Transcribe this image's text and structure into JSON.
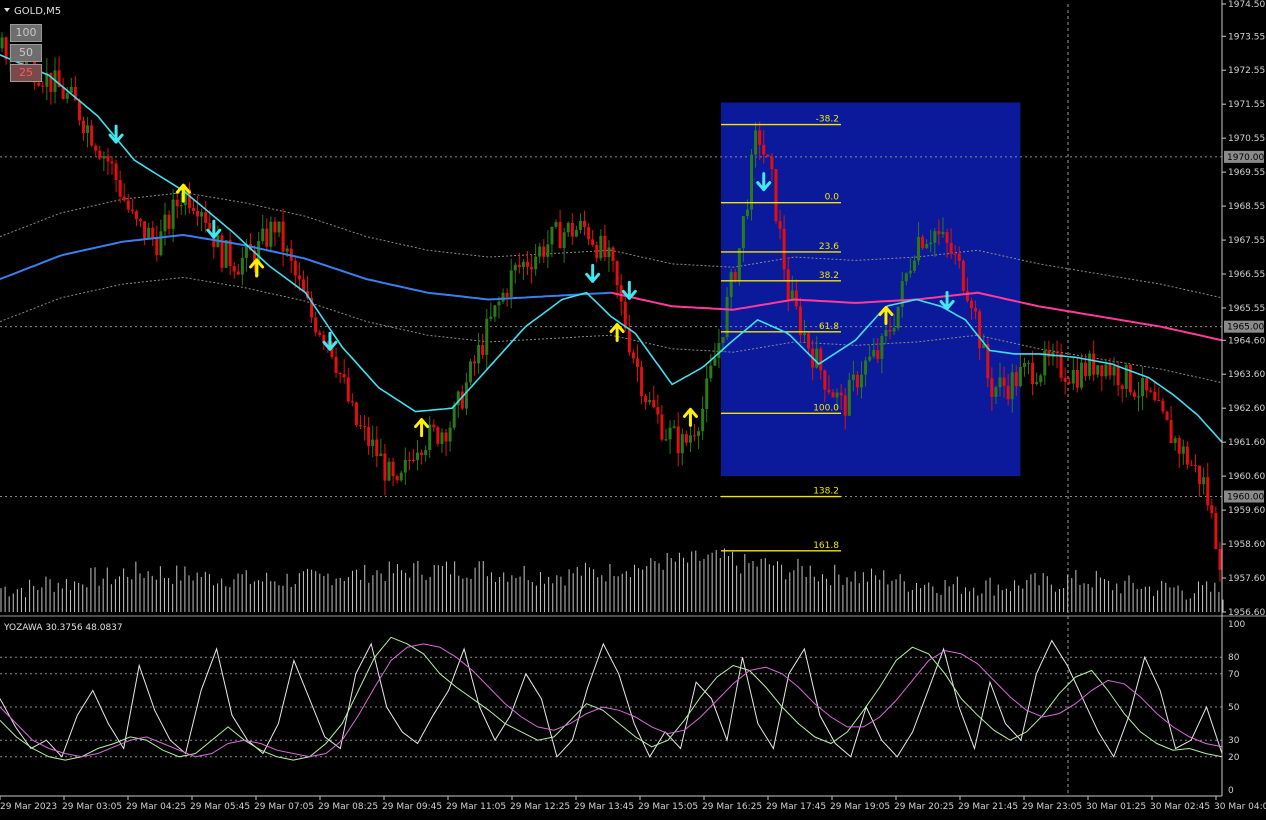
{
  "window": {
    "symbol_title": "GOLD,M5",
    "zoom_buttons": [
      "100",
      "50",
      "25"
    ],
    "active_zoom": "25"
  },
  "colors": {
    "background": "#000000",
    "bull": "#2a7a1a",
    "bear": "#e01010",
    "ma_fast": "#40e0f0",
    "ma_slow_up": "#3a7ff0",
    "ma_slow_down": "#ff3a9a",
    "fib_box": "#0b1a9a",
    "fib_line": "#f2e600",
    "arrow_up": "#ffee00",
    "arrow_down": "#40e8f0",
    "volume": "#e6e6e6",
    "osc_white": "#e8e8e8",
    "osc_green": "#b8f0a8",
    "osc_magenta": "#d86ad8",
    "grid_text": "#d0d0d0"
  },
  "chart_data": [
    {
      "type": "candlestick",
      "title": "GOLD,M5",
      "y_axis_labels": [
        "1974.50",
        "1973.55",
        "1972.55",
        "1971.55",
        "1970.55",
        "1969.55",
        "1968.55",
        "1967.55",
        "1966.55",
        "1965.55",
        "1964.60",
        "1963.60",
        "1962.60",
        "1961.60",
        "1960.60",
        "1959.60",
        "1958.60",
        "1957.60",
        "1956.60"
      ],
      "ylim": [
        1956.6,
        1974.5
      ],
      "price_markers": [
        "1970.00",
        "1965.00",
        "1960.00"
      ],
      "x_axis_labels": [
        "29 Mar 2023",
        "29 Mar 03:05",
        "29 Mar 04:25",
        "29 Mar 05:45",
        "29 Mar 07:05",
        "29 Mar 08:25",
        "29 Mar 09:45",
        "29 Mar 11:05",
        "29 Mar 12:25",
        "29 Mar 13:45",
        "29 Mar 15:05",
        "29 Mar 16:25",
        "29 Mar 17:45",
        "29 Mar 19:05",
        "29 Mar 20:25",
        "29 Mar 21:45",
        "29 Mar 23:05",
        "30 Mar 01:25",
        "30 Mar 02:45",
        "30 Mar 04:0"
      ],
      "price_path": [
        [
          0,
          1973.2
        ],
        [
          0.03,
          1972.6
        ],
        [
          0.06,
          1971.6
        ],
        [
          0.09,
          1969.8
        ],
        [
          0.11,
          1968.0
        ],
        [
          0.13,
          1967.5
        ],
        [
          0.15,
          1969.0
        ],
        [
          0.165,
          1968.6
        ],
        [
          0.18,
          1967.2
        ],
        [
          0.195,
          1966.9
        ],
        [
          0.21,
          1967.2
        ],
        [
          0.225,
          1968.0
        ],
        [
          0.24,
          1966.6
        ],
        [
          0.255,
          1965.3
        ],
        [
          0.27,
          1964.6
        ],
        [
          0.29,
          1962.2
        ],
        [
          0.31,
          1961.2
        ],
        [
          0.325,
          1960.1
        ],
        [
          0.34,
          1961.6
        ],
        [
          0.355,
          1961.8
        ],
        [
          0.37,
          1962.2
        ],
        [
          0.385,
          1963.6
        ],
        [
          0.4,
          1965.0
        ],
        [
          0.42,
          1966.6
        ],
        [
          0.44,
          1967.2
        ],
        [
          0.46,
          1967.8
        ],
        [
          0.48,
          1967.9
        ],
        [
          0.5,
          1966.8
        ],
        [
          0.515,
          1964.6
        ],
        [
          0.53,
          1962.8
        ],
        [
          0.545,
          1961.9
        ],
        [
          0.56,
          1961.5
        ],
        [
          0.575,
          1962.6
        ],
        [
          0.59,
          1964.8
        ],
        [
          0.605,
          1967.3
        ],
        [
          0.62,
          1970.8
        ],
        [
          0.632,
          1969.2
        ],
        [
          0.645,
          1966.0
        ],
        [
          0.66,
          1964.6
        ],
        [
          0.675,
          1963.5
        ],
        [
          0.69,
          1962.6
        ],
        [
          0.705,
          1963.8
        ],
        [
          0.72,
          1964.2
        ],
        [
          0.735,
          1965.6
        ],
        [
          0.75,
          1967.6
        ],
        [
          0.765,
          1967.8
        ],
        [
          0.78,
          1967.1
        ],
        [
          0.795,
          1965.9
        ],
        [
          0.81,
          1963.2
        ],
        [
          0.825,
          1963.3
        ],
        [
          0.84,
          1963.7
        ],
        [
          0.86,
          1963.9
        ],
        [
          0.88,
          1963.6
        ],
        [
          0.9,
          1964.0
        ],
        [
          0.92,
          1963.5
        ],
        [
          0.94,
          1962.9
        ],
        [
          0.955,
          1962.0
        ],
        [
          0.97,
          1961.2
        ],
        [
          0.985,
          1960.4
        ],
        [
          1.0,
          1958.0
        ]
      ],
      "moving_averages": [
        {
          "name": "fast",
          "color": "#40e0f0",
          "points": [
            [
              0,
              1973.0
            ],
            [
              0.04,
              1972.4
            ],
            [
              0.08,
              1971.2
            ],
            [
              0.11,
              1969.9
            ],
            [
              0.15,
              1969.0
            ],
            [
              0.19,
              1967.8
            ],
            [
              0.22,
              1966.8
            ],
            [
              0.25,
              1966.0
            ],
            [
              0.28,
              1964.4
            ],
            [
              0.31,
              1963.2
            ],
            [
              0.34,
              1962.5
            ],
            [
              0.37,
              1962.6
            ],
            [
              0.4,
              1963.8
            ],
            [
              0.43,
              1965.0
            ],
            [
              0.46,
              1965.8
            ],
            [
              0.48,
              1966.0
            ],
            [
              0.5,
              1965.3
            ],
            [
              0.52,
              1964.8
            ],
            [
              0.55,
              1963.3
            ],
            [
              0.575,
              1963.8
            ],
            [
              0.6,
              1964.6
            ],
            [
              0.62,
              1965.2
            ],
            [
              0.645,
              1964.8
            ],
            [
              0.67,
              1963.9
            ],
            [
              0.7,
              1964.6
            ],
            [
              0.725,
              1965.6
            ],
            [
              0.75,
              1965.8
            ],
            [
              0.77,
              1965.6
            ],
            [
              0.79,
              1965.2
            ],
            [
              0.81,
              1964.3
            ],
            [
              0.83,
              1964.2
            ],
            [
              0.85,
              1964.2
            ],
            [
              0.88,
              1964.1
            ],
            [
              0.91,
              1963.9
            ],
            [
              0.94,
              1963.5
            ],
            [
              0.96,
              1963.0
            ],
            [
              0.98,
              1962.4
            ],
            [
              1.0,
              1961.6
            ]
          ]
        },
        {
          "name": "slow",
          "color_up": "#3a7ff0",
          "color_down": "#ff3a9a",
          "points": [
            [
              0,
              1966.4
            ],
            [
              0.05,
              1967.1
            ],
            [
              0.1,
              1967.5
            ],
            [
              0.15,
              1967.7
            ],
            [
              0.2,
              1967.4
            ],
            [
              0.25,
              1967.0
            ],
            [
              0.3,
              1966.4
            ],
            [
              0.35,
              1966.0
            ],
            [
              0.4,
              1965.8
            ],
            [
              0.45,
              1965.9
            ],
            [
              0.5,
              1966.0
            ],
            [
              0.55,
              1965.6
            ],
            [
              0.6,
              1965.5
            ],
            [
              0.65,
              1965.8
            ],
            [
              0.7,
              1965.7
            ],
            [
              0.75,
              1965.8
            ],
            [
              0.8,
              1966.0
            ],
            [
              0.85,
              1965.6
            ],
            [
              0.9,
              1965.3
            ],
            [
              0.95,
              1965.0
            ],
            [
              1.0,
              1964.6
            ]
          ]
        }
      ],
      "fibonacci": {
        "levels": [
          "-38.2",
          "0.0",
          "23.6",
          "38.2",
          "61.8",
          "100.0",
          "138.2",
          "161.8"
        ],
        "prices": [
          1970.95,
          1968.65,
          1967.2,
          1966.35,
          1964.85,
          1962.45,
          1960.0,
          1958.4
        ],
        "box_price_range": [
          1960.6,
          1971.6
        ],
        "box_time_range": [
          0.59,
          0.835
        ]
      },
      "signals": {
        "down_arrows": [
          [
            0.095,
            1970.7
          ],
          [
            0.175,
            1967.9
          ],
          [
            0.27,
            1964.6
          ],
          [
            0.485,
            1966.6
          ],
          [
            0.515,
            1966.1
          ],
          [
            0.625,
            1969.3
          ],
          [
            0.775,
            1965.8
          ]
        ],
        "up_arrows": [
          [
            0.15,
            1968.9
          ],
          [
            0.21,
            1966.7
          ],
          [
            0.345,
            1962.0
          ],
          [
            0.505,
            1964.8
          ],
          [
            0.565,
            1962.3
          ],
          [
            0.725,
            1965.3
          ]
        ]
      },
      "volume": {
        "profile": [
          0.25,
          0.35,
          0.45,
          0.55,
          0.5,
          0.45,
          0.4,
          0.42,
          0.5,
          0.55,
          0.6,
          0.62,
          0.55,
          0.5,
          0.55,
          0.65,
          0.75,
          0.8,
          0.7,
          0.6,
          0.5,
          0.45,
          0.35,
          0.3,
          0.3,
          0.35,
          0.4,
          0.3,
          0.25,
          0.2
        ]
      }
    },
    {
      "type": "line",
      "title": "YOZAWA 30.3756 48.0837",
      "ylim": [
        0,
        100
      ],
      "y_axis_labels": [
        "100",
        "80",
        "70",
        "50",
        "30",
        "20",
        "0"
      ],
      "levels": [
        80,
        70,
        50,
        30,
        20
      ],
      "series": [
        {
          "color": "#e8e8e8",
          "values": [
            55,
            38,
            25,
            30,
            20,
            45,
            60,
            40,
            25,
            75,
            48,
            30,
            22,
            60,
            85,
            45,
            30,
            22,
            40,
            78,
            55,
            32,
            25,
            70,
            88,
            50,
            35,
            28,
            45,
            60,
            85,
            50,
            30,
            45,
            70,
            55,
            20,
            30,
            62,
            88,
            70,
            40,
            20,
            35,
            25,
            65,
            55,
            30,
            80,
            40,
            25,
            70,
            85,
            45,
            28,
            20,
            50,
            30,
            20,
            35,
            60,
            85,
            50,
            25,
            65,
            40,
            30,
            70,
            90,
            75,
            55,
            35,
            20,
            45,
            80,
            60,
            25,
            30,
            50,
            22
          ]
        },
        {
          "color": "#b8f0a8",
          "values": [
            42,
            32,
            25,
            20,
            18,
            20,
            25,
            28,
            32,
            30,
            24,
            20,
            22,
            30,
            38,
            30,
            24,
            20,
            18,
            20,
            28,
            40,
            60,
            80,
            92,
            88,
            82,
            70,
            62,
            55,
            48,
            40,
            35,
            30,
            32,
            42,
            52,
            48,
            40,
            32,
            26,
            30,
            42,
            56,
            68,
            75,
            72,
            62,
            50,
            40,
            32,
            28,
            35,
            48,
            62,
            78,
            86,
            82,
            70,
            55,
            45,
            36,
            30,
            35,
            45,
            58,
            68,
            72,
            60,
            46,
            35,
            28,
            24,
            25,
            22,
            20
          ]
        },
        {
          "color": "#d86ad8",
          "values": [
            50,
            40,
            30,
            25,
            22,
            20,
            22,
            26,
            30,
            32,
            28,
            24,
            20,
            22,
            28,
            30,
            28,
            24,
            22,
            20,
            22,
            30,
            45,
            62,
            78,
            86,
            88,
            86,
            80,
            72,
            62,
            52,
            44,
            38,
            36,
            40,
            46,
            50,
            48,
            44,
            38,
            34,
            36,
            44,
            54,
            64,
            72,
            74,
            70,
            62,
            52,
            44,
            38,
            38,
            44,
            54,
            66,
            78,
            84,
            82,
            76,
            66,
            56,
            48,
            44,
            46,
            52,
            60,
            66,
            64,
            56,
            46,
            38,
            32,
            28,
            26
          ]
        }
      ]
    }
  ]
}
